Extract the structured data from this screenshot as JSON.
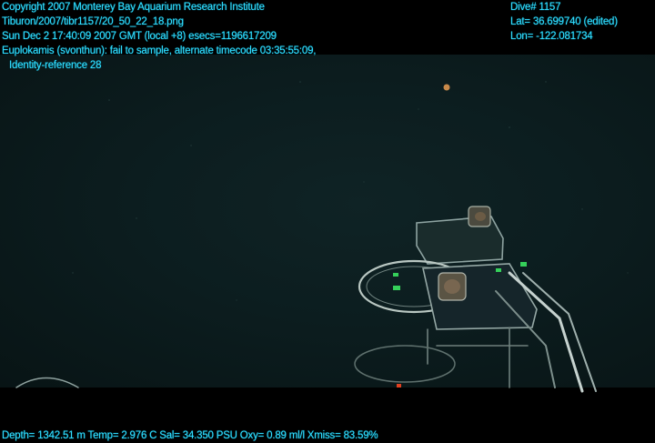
{
  "header_left": {
    "line1": "Copyright 2007 Monterey Bay Aquarium Research Institute",
    "line2": "Tiburon/2007/tibr1157/20_50_22_18.png",
    "line3": "Sun Dec  2 17:40:09 2007 GMT (local +8)  esecs=1196617209",
    "line4": "Euplokamis (svonthun): fail to sample, alternate timecode 03:35:55:09,",
    "line5": "Identity-reference 28"
  },
  "header_right": {
    "dive": "Dive# 1157",
    "lat": "Lat= 36.699740 (edited)",
    "lon": "Lon= -122.081734"
  },
  "footer": {
    "telemetry": "Depth= 1342.51 m  Temp= 2.976 C  Sal= 34.350 PSU  Oxy= 0.89 ml/l  Xmiss= 83.59%"
  },
  "colors": {
    "overlay_text": "#33ddff",
    "water": "#0c1d1f"
  }
}
